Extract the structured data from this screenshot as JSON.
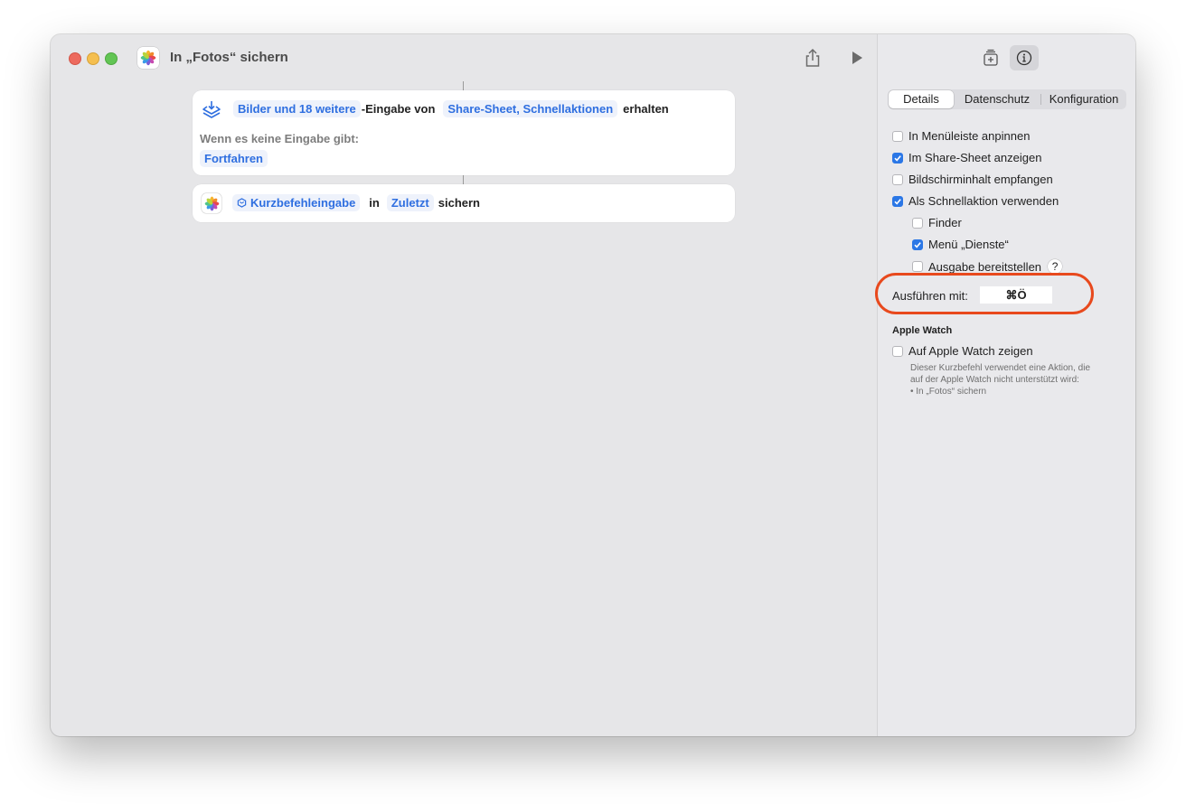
{
  "window": {
    "title": "In „Fotos“ sichern"
  },
  "workflow": {
    "receive_action": {
      "input_types": "Bilder und 18 weitere",
      "text_eingabe_von": "-Eingabe von",
      "sources": "Share-Sheet, Schnellaktionen",
      "text_erhalten": "erhalten",
      "no_input_label": "Wenn es keine Eingabe gibt:",
      "no_input_value": "Fortfahren"
    },
    "save_action": {
      "input": "Kurzbefehleingabe",
      "text_in": "in",
      "album": "Zuletzt",
      "text_sichern": "sichern"
    }
  },
  "sidebar": {
    "tabs": [
      {
        "label": "Details",
        "active": true
      },
      {
        "label": "Datenschutz",
        "active": false
      },
      {
        "label": "Konfiguration",
        "active": false
      }
    ],
    "options": [
      {
        "label": "In Menüleiste anpinnen",
        "checked": false
      },
      {
        "label": "Im Share-Sheet anzeigen",
        "checked": true
      },
      {
        "label": "Bildschirminhalt empfangen",
        "checked": false
      },
      {
        "label": "Als Schnellaktion verwenden",
        "checked": true
      }
    ],
    "sub_options": [
      {
        "label": "Finder",
        "checked": false
      },
      {
        "label": "Menü „Dienste“",
        "checked": true
      },
      {
        "label": "Ausgabe bereitstellen",
        "checked": false
      }
    ],
    "help_label": "?",
    "run_with_label": "Ausführen mit:",
    "shortcut_value": "⌘Ö",
    "apple_watch_title": "Apple Watch",
    "apple_watch_option": {
      "label": "Auf Apple Watch zeigen",
      "checked": false
    },
    "apple_watch_note_1": "Dieser Kurzbefehl verwendet eine Aktion, die",
    "apple_watch_note_2": "auf der Apple Watch nicht unterstützt wird:",
    "apple_watch_note_3": "• In „Fotos“ sichern"
  },
  "colors": {
    "accent": "#2b77e6",
    "link_blue": "#2f6fe0",
    "highlight_ring": "#e8491d"
  }
}
